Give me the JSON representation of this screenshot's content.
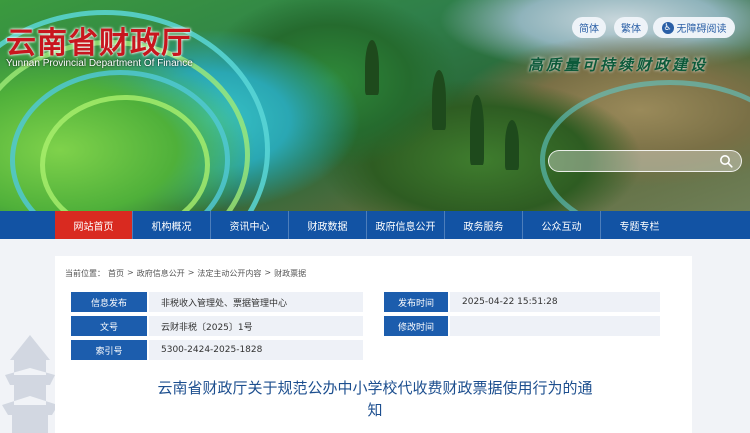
{
  "header": {
    "logo_cn": "云南省财政厅",
    "logo_en": "Yunnan Provincial Department Of Finance",
    "slogan": "高质量可持续财政建设",
    "lang_simplified": "简体",
    "lang_traditional": "繁体",
    "accessibility": "无障碍阅读",
    "search_placeholder": ""
  },
  "nav": {
    "items": [
      "网站首页",
      "机构概况",
      "资讯中心",
      "财政数据",
      "政府信息公开",
      "政务服务",
      "公众互动",
      "专题专栏"
    ],
    "active_index": 0
  },
  "breadcrumb": {
    "prefix": "当前位置：",
    "items": [
      "首页",
      "政府信息公开",
      "法定主动公开内容",
      "财政票据"
    ],
    "separator": ">"
  },
  "meta": {
    "publisher_label": "信息发布",
    "publisher_value": "非税收入管理处、票据管理中心",
    "docno_label": "文号",
    "docno_value": "云财非税〔2025〕1号",
    "index_label": "索引号",
    "index_value": "5300-2424-2025-1828",
    "pubtime_label": "发布时间",
    "pubtime_value": "2025-04-22 15:51:28",
    "modtime_label": "修改时间",
    "modtime_value": ""
  },
  "article": {
    "title_line1": "云南省财政厅关于规范公办中小学校代收费财政票据使用行为的通",
    "title_line2": "知"
  },
  "colors": {
    "nav_bg": "#1253a4",
    "nav_active": "#d92a20",
    "label_bg": "#1c5dad",
    "logo_red": "#c8161e",
    "title_blue": "#1d4f8f"
  }
}
